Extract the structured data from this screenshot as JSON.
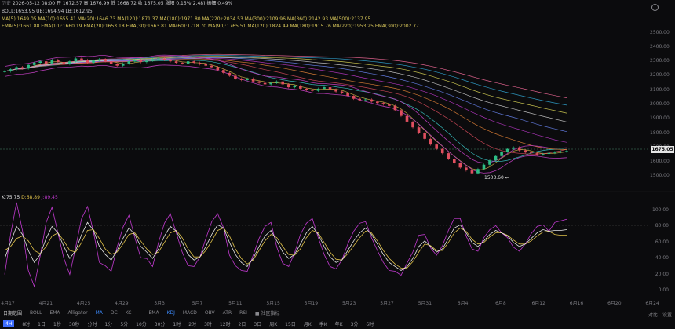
{
  "header": {
    "line1_label": "历史",
    "line1": "2026-05-12 08:00  开 1672.57  高 1676.99  低 1668.72  收 1675.05  涨幅 0.15%(2.48)  振幅 0.49%",
    "boll_label": "BOLL",
    "boll": "BOLL:1653.95  UB:1694.94  LB:1612.95",
    "ma_line1": "MA(5):1649.05  MA(10):1655.41  MA(20):1646.73  MA(120):1871.37  MA(180):1971.80  MA(220):2034.53  MA(300):2109.96  MA(360):2142.93  MA(500):2137.95",
    "ma_line2": "EMA(5):1661.88  EMA(10):1660.19  EMA(20):1653.18  EMA(30):1663.81  MA(60):1718.70  MA(90):1765.51  MA(120):1824.49  MA(180):1915.76  MA(220):1953.25  EMA(300):2002.77"
  },
  "price_axis": [
    "2500.00",
    "2400.00",
    "2300.00",
    "2200.00",
    "2100.00",
    "2000.00",
    "1900.00",
    "1800.00",
    "1700.00",
    "1600.00",
    "1500.00"
  ],
  "current_price": "1675.05",
  "low_marker": "1503.60 ←",
  "kdj_legend": {
    "k": "K:75.75",
    "d": "D:68.89",
    "j": "J:89.45"
  },
  "kdj_axis": [
    "100.00",
    "80.00",
    "60.00",
    "40.00",
    "20.00",
    "0.00"
  ],
  "x_ticks": [
    "4月17",
    "4月21",
    "4月25",
    "4月29",
    "5月3",
    "5月7",
    "5月11",
    "5月15",
    "5月19",
    "5月23",
    "5月27",
    "5月31",
    "6月4",
    "6月8",
    "6月12",
    "6月16",
    "6月20",
    "6月24"
  ],
  "toolbar_main": {
    "items": [
      "日期范围",
      "BOLL",
      "EMA",
      "Alligator",
      "MA",
      "DC",
      "KC"
    ],
    "active": "MA",
    "items2": [
      "EMA",
      "KDJ",
      "MACD",
      "OBV",
      "ATR",
      "RSI",
      "■ 社区指标"
    ],
    "active2": "KDJ"
  },
  "timeframes": [
    "4H",
    "8时",
    "1日",
    "1秒",
    "30秒",
    "分时",
    "1分",
    "5分",
    "10分",
    "30分",
    "1时",
    "2时",
    "3时",
    "12时",
    "2日",
    "3日",
    "周K",
    "15日",
    "月K",
    "季K",
    "年K",
    "3分",
    "6时"
  ],
  "selected_timeframe": "4H",
  "right_tools": [
    "对比",
    "设置"
  ],
  "colors": {
    "up": "#2ebd85",
    "down": "#e04f5f",
    "boll_band": "#b03ab0",
    "k_line": "#e6e6e6",
    "d_line": "#e0c24a",
    "j_line": "#c23ad0",
    "accent": "#3d6dfd"
  },
  "chart_data": {
    "type": "candlestick",
    "ylim": [
      1480,
      2520
    ],
    "current": 1675.05,
    "low": 1503.6,
    "close_series": [
      2230,
      2245,
      2260,
      2250,
      2275,
      2290,
      2300,
      2285,
      2310,
      2295,
      2280,
      2300,
      2320,
      2310,
      2290,
      2305,
      2315,
      2300,
      2280,
      2270,
      2285,
      2300,
      2310,
      2295,
      2305,
      2315,
      2320,
      2310,
      2300,
      2290,
      2285,
      2300,
      2290,
      2280,
      2270,
      2260,
      2240,
      2220,
      2200,
      2180,
      2170,
      2180,
      2160,
      2150,
      2140,
      2150,
      2160,
      2140,
      2120,
      2130,
      2110,
      2100,
      2095,
      2110,
      2120,
      2105,
      2090,
      2080,
      2060,
      2040,
      2030,
      2035,
      2020,
      2010,
      2000,
      1990,
      1960,
      1920,
      1880,
      1840,
      1800,
      1760,
      1720,
      1690,
      1660,
      1620,
      1590,
      1560,
      1540,
      1520,
      1550,
      1580,
      1610,
      1640,
      1670,
      1690,
      1700,
      1680,
      1665,
      1660,
      1650,
      1655,
      1662,
      1668,
      1672,
      1675
    ],
    "kdj": {
      "k": [
        40,
        60,
        80,
        70,
        50,
        35,
        45,
        65,
        80,
        72,
        55,
        40,
        50,
        70,
        85,
        75,
        55,
        45,
        38,
        50,
        65,
        78,
        70,
        55,
        48,
        40,
        52,
        68,
        80,
        74,
        60,
        45,
        38,
        42,
        55,
        70,
        82,
        78,
        60,
        45,
        35,
        30,
        40,
        55,
        68,
        75,
        62,
        48,
        40,
        45,
        58,
        72,
        80,
        70,
        55,
        42,
        35,
        38,
        50,
        62,
        72,
        78,
        70,
        58,
        45,
        35,
        30,
        25,
        30,
        40,
        55,
        62,
        55,
        48,
        52,
        65,
        78,
        82,
        72,
        60,
        55,
        62,
        70,
        75,
        72,
        68,
        60,
        55,
        58,
        65,
        72,
        76,
        74,
        75,
        75,
        76
      ],
      "d": [
        50,
        55,
        65,
        68,
        62,
        50,
        46,
        55,
        68,
        72,
        62,
        50,
        48,
        60,
        75,
        76,
        65,
        52,
        45,
        48,
        58,
        70,
        72,
        62,
        52,
        45,
        48,
        60,
        72,
        75,
        66,
        52,
        42,
        42,
        50,
        62,
        75,
        78,
        68,
        52,
        40,
        33,
        38,
        50,
        62,
        70,
        66,
        55,
        45,
        44,
        52,
        66,
        75,
        72,
        60,
        48,
        39,
        38,
        46,
        56,
        66,
        74,
        72,
        62,
        50,
        40,
        33,
        28,
        28,
        36,
        48,
        58,
        56,
        50,
        50,
        60,
        72,
        78,
        74,
        64,
        58,
        60,
        67,
        72,
        72,
        69,
        63,
        58,
        58,
        62,
        68,
        73,
        74,
        70,
        69,
        69
      ],
      "j": [
        20,
        70,
        110,
        75,
        25,
        5,
        43,
        85,
        104,
        72,
        40,
        20,
        54,
        90,
        105,
        73,
        35,
        31,
        24,
        54,
        79,
        94,
        66,
        41,
        40,
        30,
        60,
        84,
        96,
        72,
        48,
        31,
        30,
        42,
        65,
        86,
        96,
        78,
        44,
        31,
        25,
        24,
        44,
        65,
        80,
        85,
        54,
        34,
        30,
        47,
        70,
        84,
        90,
        66,
        45,
        30,
        27,
        38,
        58,
        74,
        84,
        86,
        66,
        50,
        35,
        25,
        24,
        19,
        34,
        48,
        69,
        70,
        53,
        44,
        56,
        75,
        90,
        90,
        68,
        52,
        49,
        66,
        76,
        81,
        72,
        66,
        54,
        49,
        58,
        71,
        80,
        82,
        74,
        85,
        87,
        89
      ]
    }
  }
}
